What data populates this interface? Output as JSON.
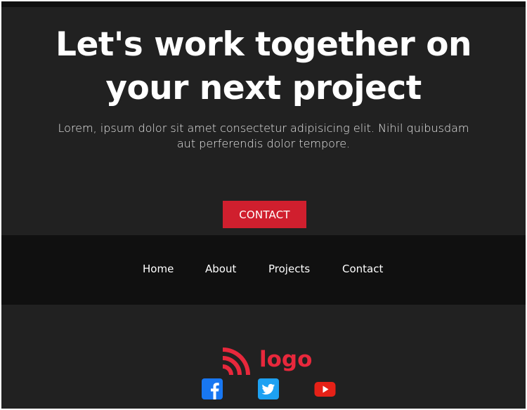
{
  "hero": {
    "title_line1": "Let's work together on",
    "title_line2": "your next project",
    "subtitle_line1": "Lorem, ipsum dolor sit amet consectetur adipisicing elit. Nihil quibusdam",
    "subtitle_line2": "aut perferendis dolor tempore.",
    "cta_label": "CONTACT"
  },
  "nav": {
    "items": [
      {
        "label": "Home"
      },
      {
        "label": "About"
      },
      {
        "label": "Projects"
      },
      {
        "label": "Contact"
      }
    ]
  },
  "footer": {
    "logo_text": "logo",
    "logo_icon": "signal-waves-icon",
    "social": [
      {
        "name": "facebook-icon",
        "color": "#1877f2"
      },
      {
        "name": "twitter-icon",
        "color": "#1da1f2"
      },
      {
        "name": "youtube-icon",
        "color": "#e62117"
      }
    ]
  },
  "colors": {
    "hero_background": "#212121",
    "nav_background": "#101010",
    "accent": "#d01f2e",
    "logo_red": "#e8283c"
  }
}
